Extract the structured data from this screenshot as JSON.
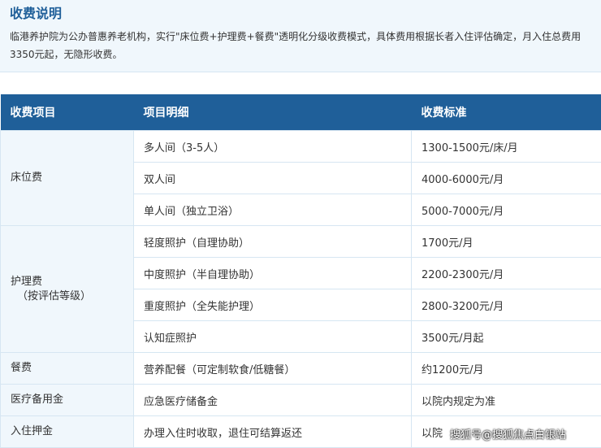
{
  "intro": {
    "title": "收费说明",
    "text": "临港养护院为公办普惠养老机构，实行\"床位费+护理费+餐费\"透明化分级收费模式，具体费用根据长者入住评估确定，月入住总费用3350元起，无隐形收费。"
  },
  "table": {
    "headers": [
      "收费项目",
      "项目明细",
      "收费标准"
    ],
    "groups": [
      {
        "category": "床位费",
        "rows": [
          {
            "detail": "多人间（3-5人）",
            "price": "1300-1500元/床/月"
          },
          {
            "detail": "双人间",
            "price": "4000-6000元/月"
          },
          {
            "detail": "单人间（独立卫浴）",
            "price": "5000-7000元/月"
          }
        ]
      },
      {
        "category": "护理费",
        "category_sub": "（按评估等级）",
        "rows": [
          {
            "detail": "轻度照护（自理协助）",
            "price": "1700元/月"
          },
          {
            "detail": "中度照护（半自理协助）",
            "price": "2200-2300元/月"
          },
          {
            "detail": "重度照护（全失能护理）",
            "price": "2800-3200元/月"
          },
          {
            "detail": "认知症照护",
            "price": "3500元/月起"
          }
        ]
      },
      {
        "category": "餐费",
        "rows": [
          {
            "detail": "营养配餐（可定制软食/低糖餐）",
            "price": "约1200元/月"
          }
        ]
      },
      {
        "category": "医疗备用金",
        "rows": [
          {
            "detail": "应急医疗储备金",
            "price": "以院内规定为准"
          }
        ]
      },
      {
        "category": "入住押金",
        "rows": [
          {
            "detail": "办理入住时收取，退住可结算返还",
            "price": "以院"
          }
        ]
      }
    ]
  },
  "watermark": "搜狐号@搜狐焦点白银站"
}
